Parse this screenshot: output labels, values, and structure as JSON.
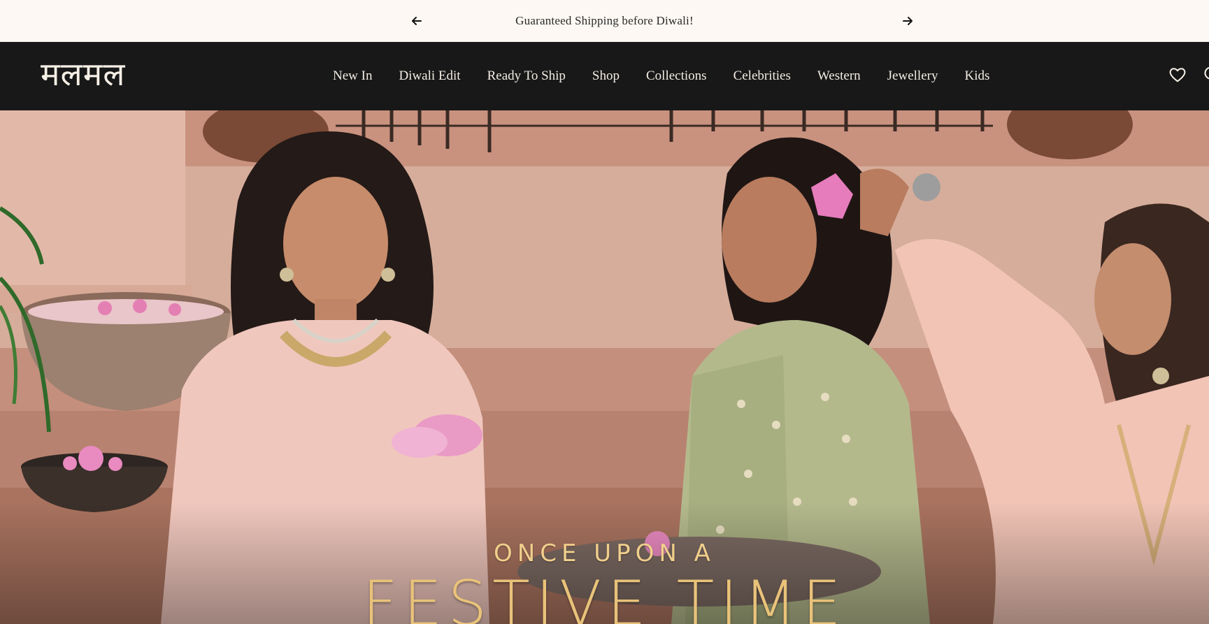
{
  "announcement": {
    "message": "Guaranteed Shipping before Diwali!",
    "prev_icon": "arrow-left-icon",
    "next_icon": "arrow-right-icon"
  },
  "header": {
    "logo": "मलमल",
    "nav": [
      {
        "label": "New In"
      },
      {
        "label": "Diwali Edit"
      },
      {
        "label": "Ready To Ship"
      },
      {
        "label": "Shop"
      },
      {
        "label": "Collections"
      },
      {
        "label": "Celebrities"
      },
      {
        "label": "Western"
      },
      {
        "label": "Jewellery"
      },
      {
        "label": "Kids"
      }
    ],
    "icons": [
      "heart-icon",
      "search-icon"
    ]
  },
  "hero": {
    "subtitle": "ONCE UPON A",
    "title": "FESTIVE TIME"
  },
  "colors": {
    "announcement_bg": "#fdf8f3",
    "header_bg": "#181818",
    "nav_text": "#f3ede4",
    "hero_gold": "#e9c27a"
  }
}
